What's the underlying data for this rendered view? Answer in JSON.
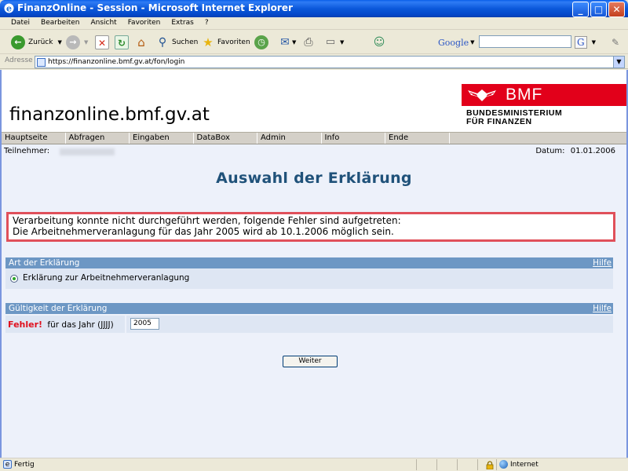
{
  "window": {
    "title": "FinanzOnline - Session - Microsoft Internet Explorer",
    "controls": {
      "minimize": "_",
      "maximize": "□",
      "close": "✕"
    }
  },
  "menu": [
    "Datei",
    "Bearbeiten",
    "Ansicht",
    "Favoriten",
    "Extras",
    "?"
  ],
  "toolbar": {
    "back_label": "Zurück",
    "search_label": "Suchen",
    "favorites_label": "Favoriten",
    "google_label": "Google",
    "google_query": ""
  },
  "address": {
    "label": "Adresse",
    "url": "https://finanzonline.bmf.gv.at/fon/login"
  },
  "site": {
    "title": "finanzonline.bmf.gv.at",
    "logo_text": "BMF",
    "logo_sub_1": "BUNDESMINISTERIUM",
    "logo_sub_2": "FÜR FINANZEN"
  },
  "nav": [
    "Hauptseite",
    "Abfragen",
    "Eingaben",
    "DataBox",
    "Admin",
    "Info",
    "Ende"
  ],
  "session": {
    "participant_label": "Teilnehmer:",
    "date_label": "Datum:",
    "date_value": "01.01.2006"
  },
  "page": {
    "heading": "Auswahl der Erklärung",
    "error_line_1": "Verarbeitung konnte nicht durchgeführt werden, folgende Fehler sind aufgetreten:",
    "error_line_2": "Die Arbeitnehmerveranlagung für das Jahr 2005 wird ab 10.1.2006 möglich sein."
  },
  "sections": {
    "type": {
      "title": "Art der Erklärung",
      "help": "Hilfe",
      "option": "Erklärung zur Arbeitnehmerveranlagung"
    },
    "validity": {
      "title": "Gültigkeit der Erklärung",
      "help": "Hilfe",
      "error_word": "Fehler!",
      "year_label": "für das Jahr (JJJJ)",
      "year_value": "2005"
    }
  },
  "submit_label": "Weiter",
  "status": {
    "left": "Fertig",
    "zone": "Internet"
  },
  "colors": {
    "heading": "#20527a",
    "section_header": "#6d97c4",
    "error_border": "#e0505a",
    "bmf_red": "#e2001a"
  }
}
